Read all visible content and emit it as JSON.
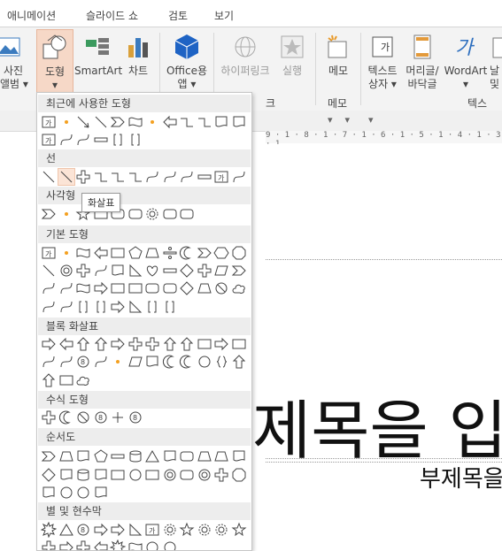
{
  "tabs": [
    "애니메이션",
    "슬라이드 쇼",
    "검토",
    "보기"
  ],
  "ribbon": {
    "photo_album": {
      "line1": "사진",
      "line2": "앨범 ▾"
    },
    "shapes": {
      "line1": "도형",
      "line2": "▾"
    },
    "smartart": "SmartArt",
    "chart": "차트",
    "office_apps": {
      "line1": "Office용",
      "line2": "앱 ▾"
    },
    "hyperlink": "하이퍼링크",
    "action": "실행",
    "comment": "메모",
    "group_comment": "메모",
    "textbox": {
      "line1": "텍스트",
      "line2": "상자 ▾"
    },
    "header_footer": {
      "line1": "머리글/",
      "line2": "바닥글"
    },
    "wordart": {
      "line1": "WordArt",
      "line2": "▾"
    },
    "date": {
      "line1": "날",
      "line2": "및"
    },
    "group_text": "텍스",
    "group_links_tail": "크"
  },
  "menu": {
    "sections": {
      "recent": "최근에 사용한 도형",
      "lines": "선",
      "rect": "사각형",
      "basic": "기본 도형",
      "block_arrows": "블록 화살표",
      "equation": "수식 도형",
      "flowchart": "순서도",
      "stars": "별 및 현수막"
    },
    "tooltip": "화살표"
  },
  "ruler": "9 · 1 · 8 · 1 · 7 · 1 · 6 · 1 · 5 · 1 · 4 · 1 · 3 · 1",
  "slide": {
    "title": "제목을 입",
    "subtitle": "부제목을"
  },
  "colors": {
    "accent": "#c43e1c",
    "active_bg": "#f6d8c7",
    "orange_dot": "#f4a020"
  }
}
